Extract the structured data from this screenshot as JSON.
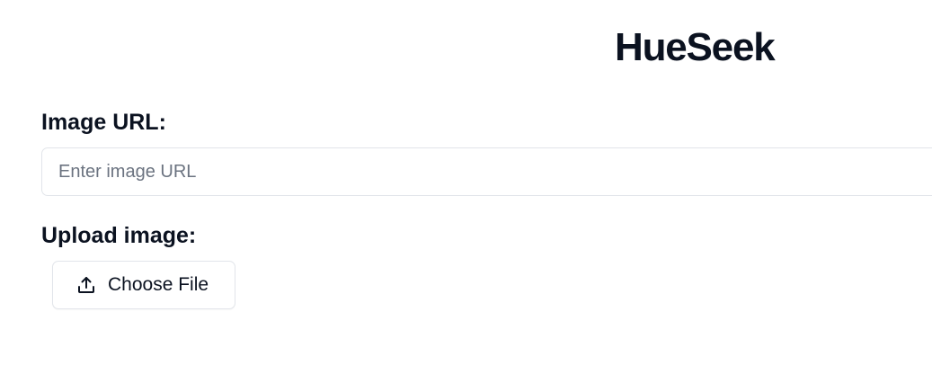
{
  "header": {
    "title": "HueSeek"
  },
  "form": {
    "url_label": "Image URL:",
    "url_placeholder": "Enter image URL",
    "url_value": "",
    "upload_label": "Upload image:",
    "choose_file_label": "Choose File",
    "upload_icon": "upload-icon"
  }
}
